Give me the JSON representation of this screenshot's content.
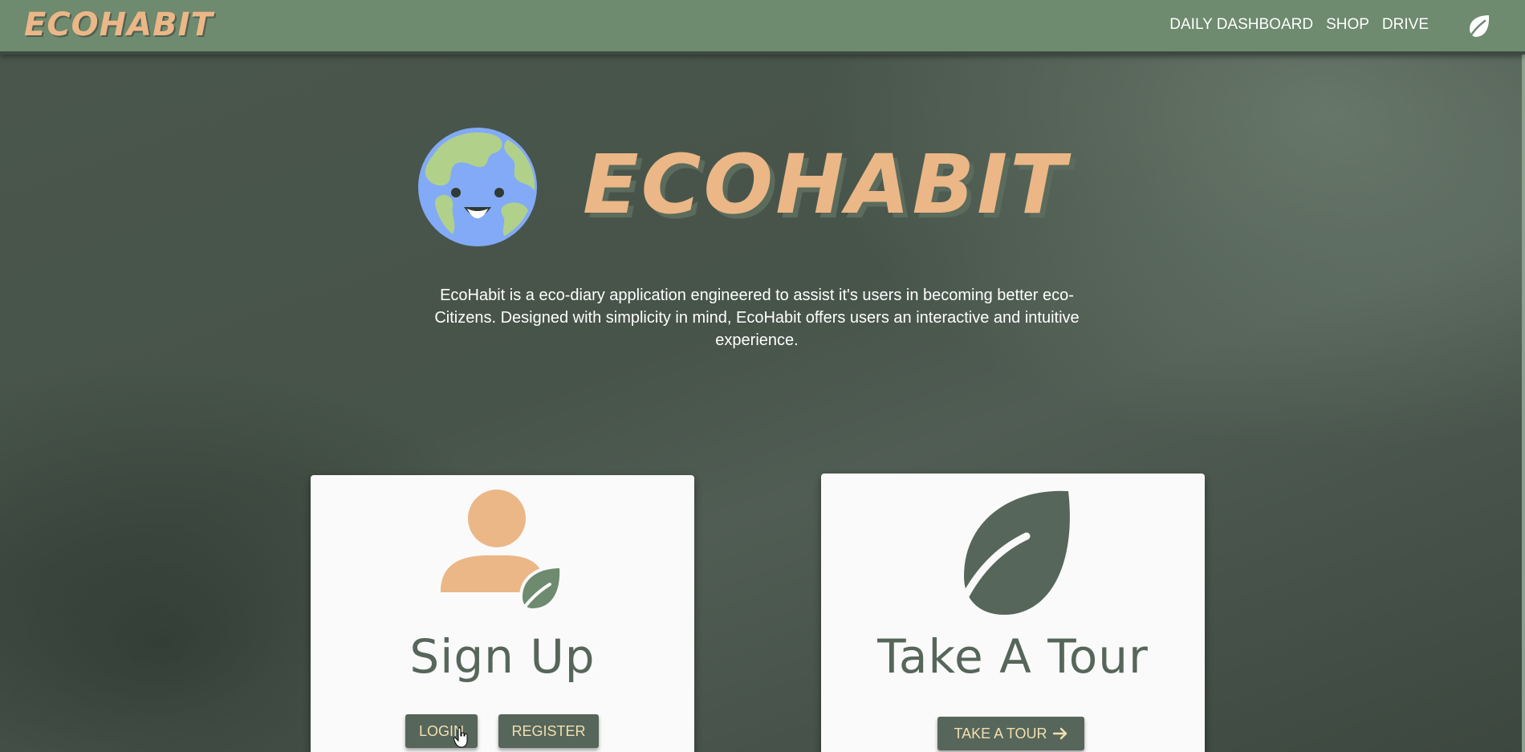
{
  "navbar": {
    "brand": "ECOHABIT",
    "links": [
      "DAILY DASHBOARD",
      "SHOP",
      "DRIVE"
    ],
    "leaf_icon": "leaf-icon"
  },
  "hero": {
    "title": "ECOHABIT",
    "description": "EcoHabit is a eco-diary application engineered to assist it's users in becoming better eco-Citizens. Designed with simplicity in mind, EcoHabit offers users an interactive and intuitive experience.",
    "globe_icon": "smiling-globe-icon"
  },
  "cards": {
    "signup": {
      "title": "Sign Up",
      "login_label": "LOGIN",
      "register_label": "REGISTER",
      "icon": "user-leaf-icon"
    },
    "tour": {
      "title": "Take A Tour",
      "button_label": "TAKE A TOUR",
      "icon": "leaf-icon"
    }
  },
  "colors": {
    "navbar": "#6e8a6f",
    "accent": "#ebb787",
    "button": "#56665a",
    "button_text": "#f3dfb0",
    "card": "#fafafa"
  }
}
